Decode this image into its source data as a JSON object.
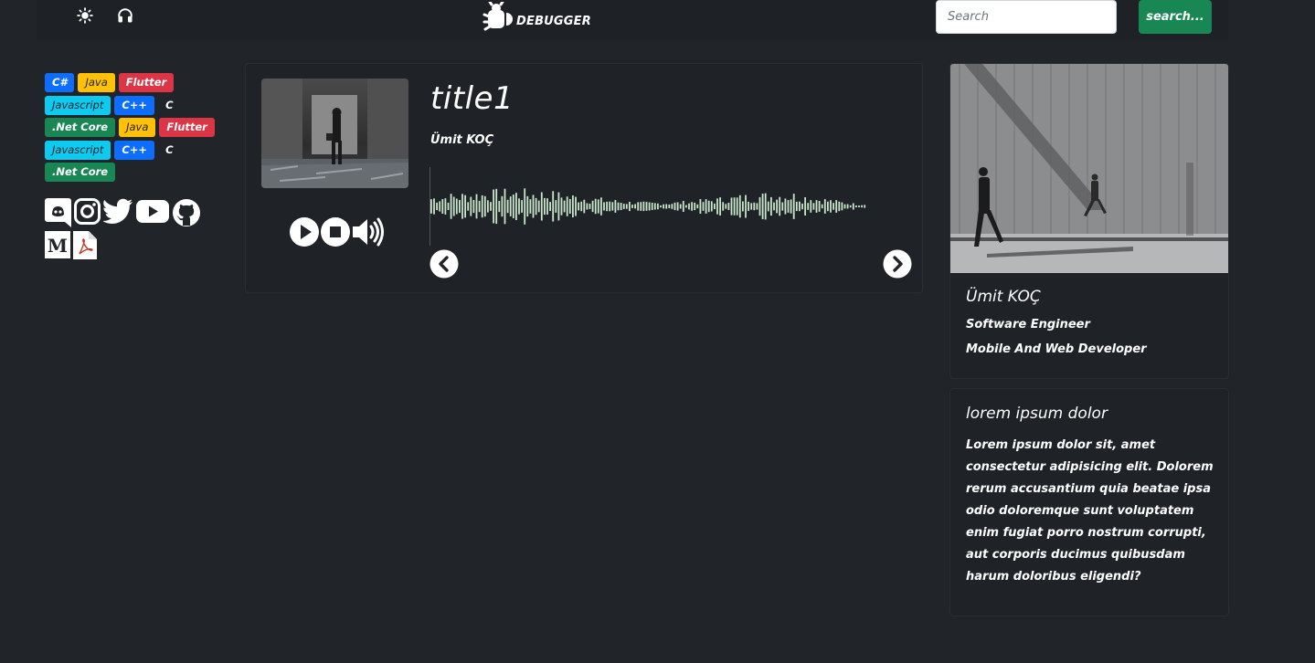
{
  "header": {
    "brand_text": "DEBUGGER",
    "search_placeholder": "Search",
    "search_button_label": "search..."
  },
  "badges": [
    [
      {
        "label": "C#",
        "color": "#0d6efd"
      },
      {
        "label": "Java",
        "color": "#ffc107"
      },
      {
        "label": "Flutter",
        "color": "#dc3545"
      }
    ],
    [
      {
        "label": "Javascript",
        "color": "#0dcaf0"
      },
      {
        "label": "C++",
        "color": "#0d6efd"
      },
      {
        "label": "C",
        "color": "transparent"
      }
    ],
    [
      {
        "label": ".Net Core",
        "color": "#198754"
      },
      {
        "label": "Java",
        "color": "#ffc107"
      },
      {
        "label": "Flutter",
        "color": "#dc3545"
      }
    ],
    [
      {
        "label": "Javascript",
        "color": "#0dcaf0"
      },
      {
        "label": "C++",
        "color": "#0d6efd"
      },
      {
        "label": "C",
        "color": "transparent"
      }
    ],
    [
      {
        "label": ".Net Core",
        "color": "#198754"
      }
    ]
  ],
  "social_icons": [
    "discord-icon",
    "instagram-icon",
    "twitter-icon",
    "youtube-icon",
    "github-icon",
    "medium-icon",
    "pdf-icon"
  ],
  "player": {
    "title": "title1",
    "artist": "Ümit KOÇ",
    "waveform_color": "#c8e6c9"
  },
  "profile": {
    "name": "Ümit KOÇ",
    "role": "Software Engineer",
    "subtitle": "Mobile And Web Developer"
  },
  "about": {
    "title": "lorem ipsum dolor",
    "body": "Lorem ipsum dolor sit, amet consectetur adipisicing elit. Dolorem rerum accusantium quia beatae ipsa odio doloremque sunt voluptatem enim fugiat porro nostrum corrupti, aut corporis ducimus quibusdam harum doloribus eligendi?"
  }
}
